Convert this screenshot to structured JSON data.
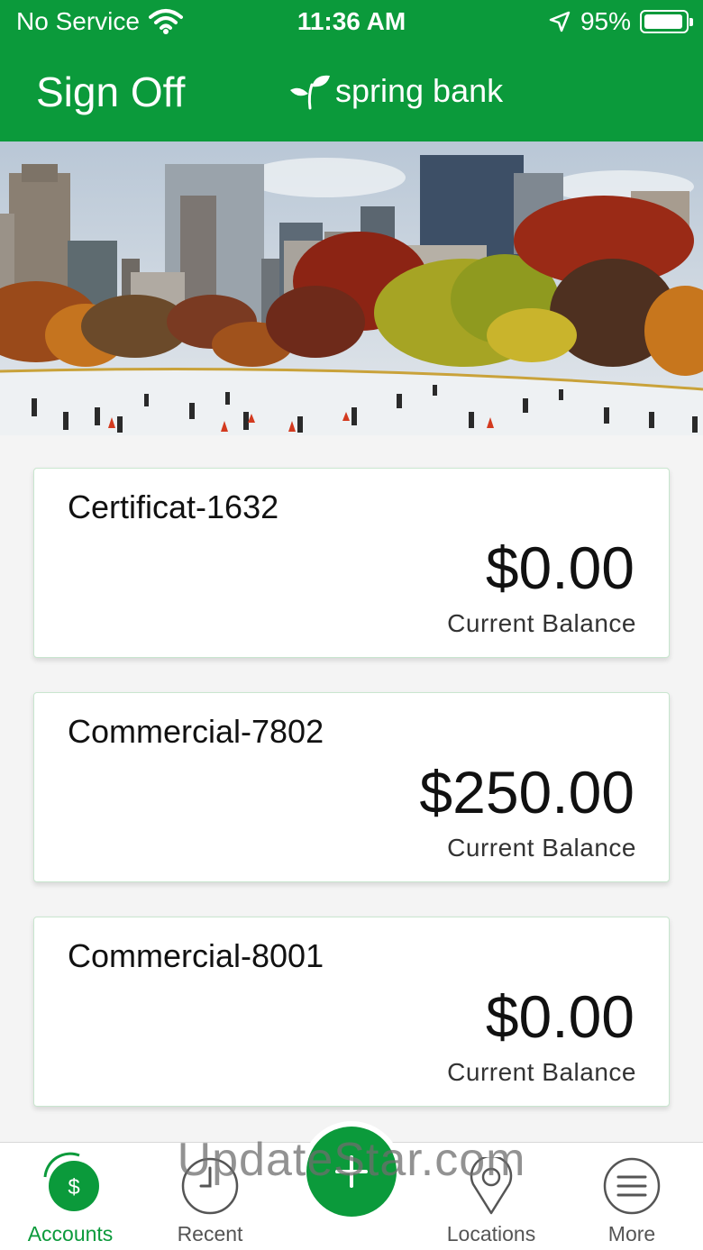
{
  "status_bar": {
    "carrier": "No Service",
    "time": "11:36 AM",
    "battery": "95%",
    "battery_level": 0.95
  },
  "header": {
    "sign_off_label": "Sign Off",
    "brand_name": "spring bank",
    "brand_icon": "sprout-icon",
    "color": "#0b9a3b"
  },
  "hero": {
    "icon": "city-park-skating-rink-photo"
  },
  "accounts": [
    {
      "name": "Certificat-1632",
      "amount": "$0.00",
      "label": "Current Balance"
    },
    {
      "name": "Commercial-7802",
      "amount": "$250.00",
      "label": "Current Balance"
    },
    {
      "name": "Commercial-8001",
      "amount": "$0.00",
      "label": "Current Balance"
    }
  ],
  "nav": {
    "accounts": {
      "label": "Accounts",
      "icon": "dollar-icon"
    },
    "recent": {
      "label": "Recent",
      "icon": "clock-icon"
    },
    "add": {
      "icon": "plus-icon"
    },
    "locations": {
      "label": "Locations",
      "icon": "map-pin-icon"
    },
    "more": {
      "label": "More",
      "icon": "menu-icon"
    }
  },
  "watermark": "UpdateStar.com"
}
